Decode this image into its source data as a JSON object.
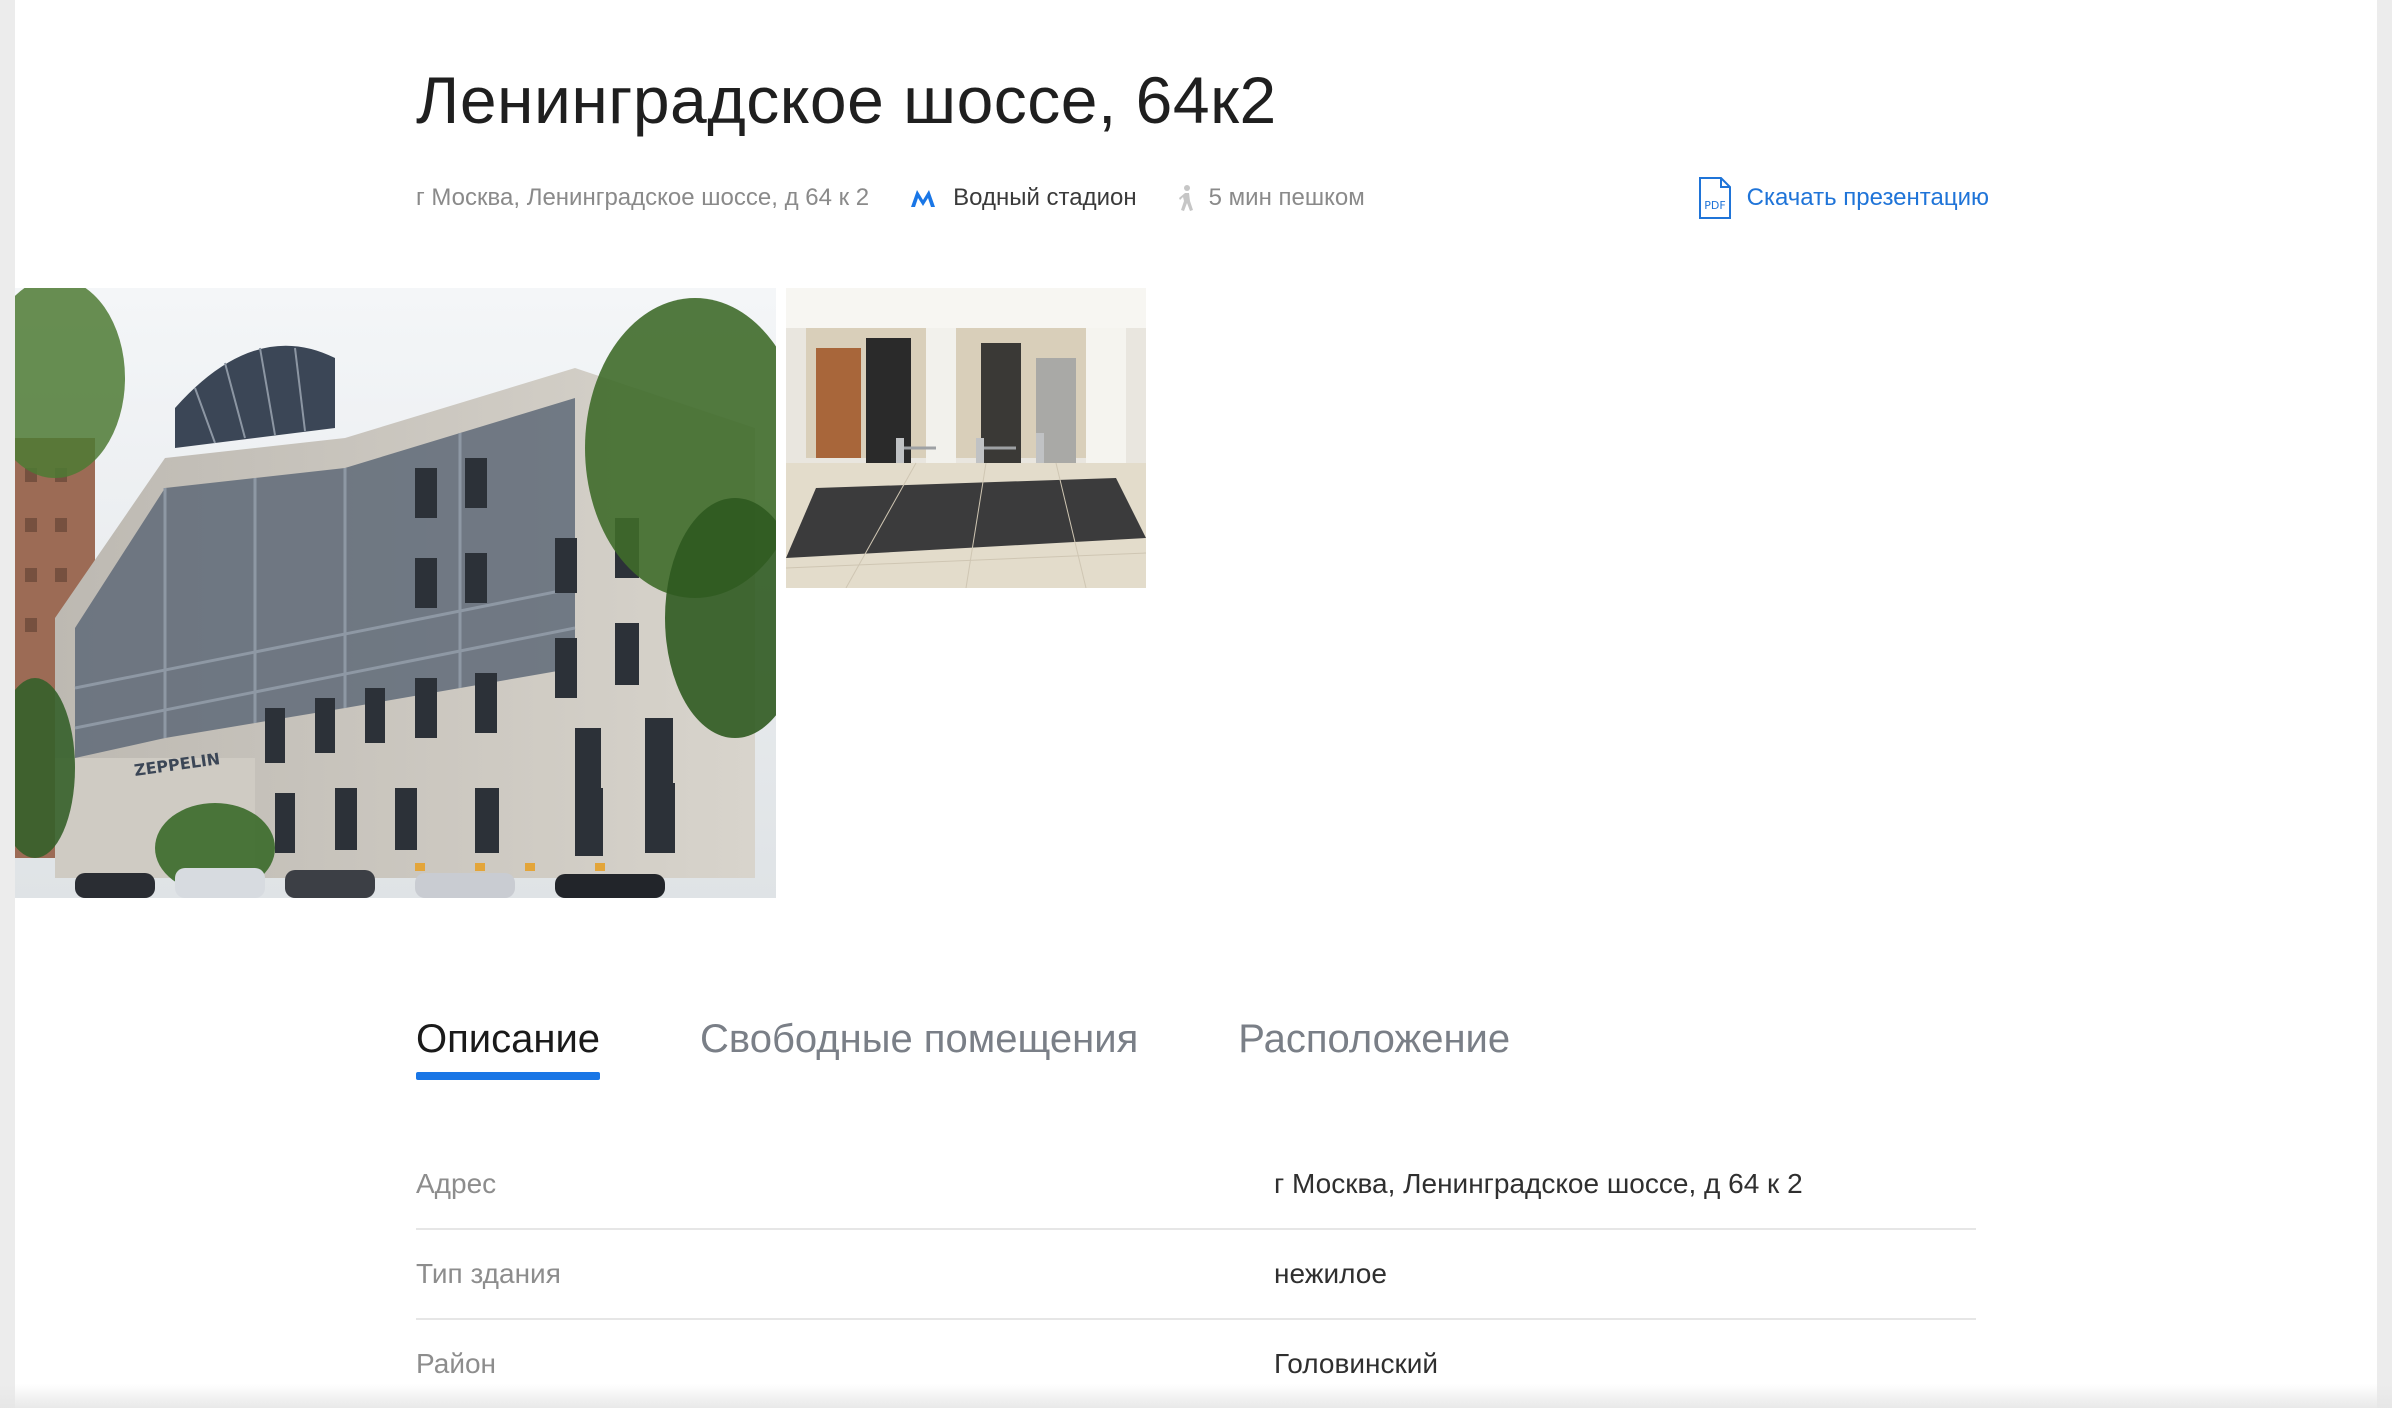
{
  "header": {
    "title": "Ленинградское шоссе, 64к2",
    "address": "г Москва, Ленинградское шоссе, д 64 к 2",
    "metro_station": "Водный стадион",
    "walk_time": "5 мин пешком",
    "download_label": "Скачать презентацию",
    "pdf_icon_text": "PDF",
    "accent_color": "#1976e6"
  },
  "gallery": {
    "main_photo": "building-exterior-photo",
    "second_photo": "lobby-interior-photo",
    "sign_text": "ZEPPELIN"
  },
  "tabs": [
    {
      "label": "Описание",
      "active": true
    },
    {
      "label": "Свободные помещения",
      "active": false
    },
    {
      "label": "Расположение",
      "active": false
    }
  ],
  "properties": [
    {
      "label": "Адрес",
      "value": "г Москва, Ленинградское шоссе, д 64 к 2"
    },
    {
      "label": "Тип здания",
      "value": "нежилое"
    },
    {
      "label": "Район",
      "value": "Головинский"
    }
  ]
}
